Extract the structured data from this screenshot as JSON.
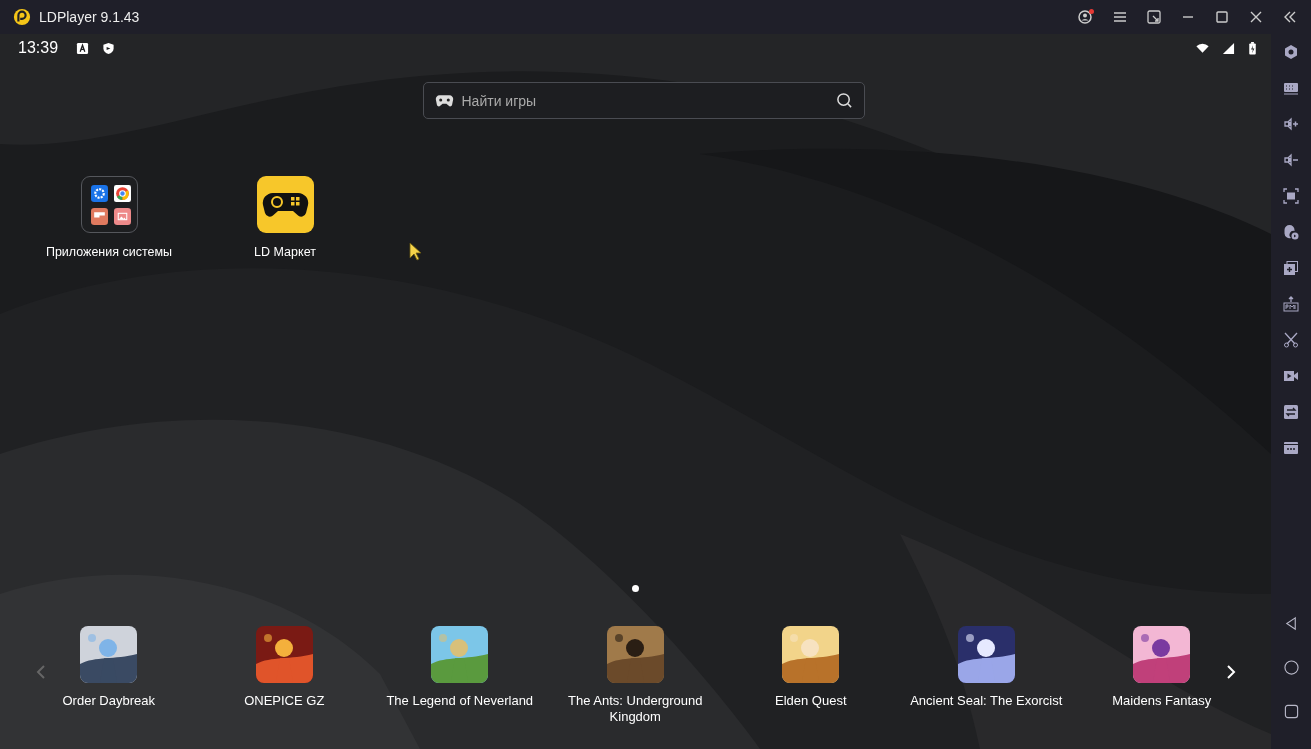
{
  "window": {
    "title": "LDPlayer 9.1.43"
  },
  "status_bar": {
    "time": "13:39"
  },
  "search": {
    "placeholder": "Найти игры"
  },
  "desktop_apps": [
    {
      "label": "Приложения системы",
      "kind": "folder"
    },
    {
      "label": "LD Маркет",
      "kind": "market"
    }
  ],
  "page_dots": [
    {
      "selected": true
    }
  ],
  "dock": [
    {
      "label": "Order Daybreak",
      "kind": "picture"
    },
    {
      "label": "ONEPICE GZ",
      "kind": "picture"
    },
    {
      "label": "The Legend of Neverland",
      "kind": "picture"
    },
    {
      "label": "The Ants: Underground Kingdom",
      "kind": "picture"
    },
    {
      "label": "Elden Quest",
      "kind": "picture"
    },
    {
      "label": "Ancient Seal: The Exorcist",
      "kind": "picture"
    },
    {
      "label": "Maidens Fantasy",
      "kind": "picture"
    }
  ]
}
